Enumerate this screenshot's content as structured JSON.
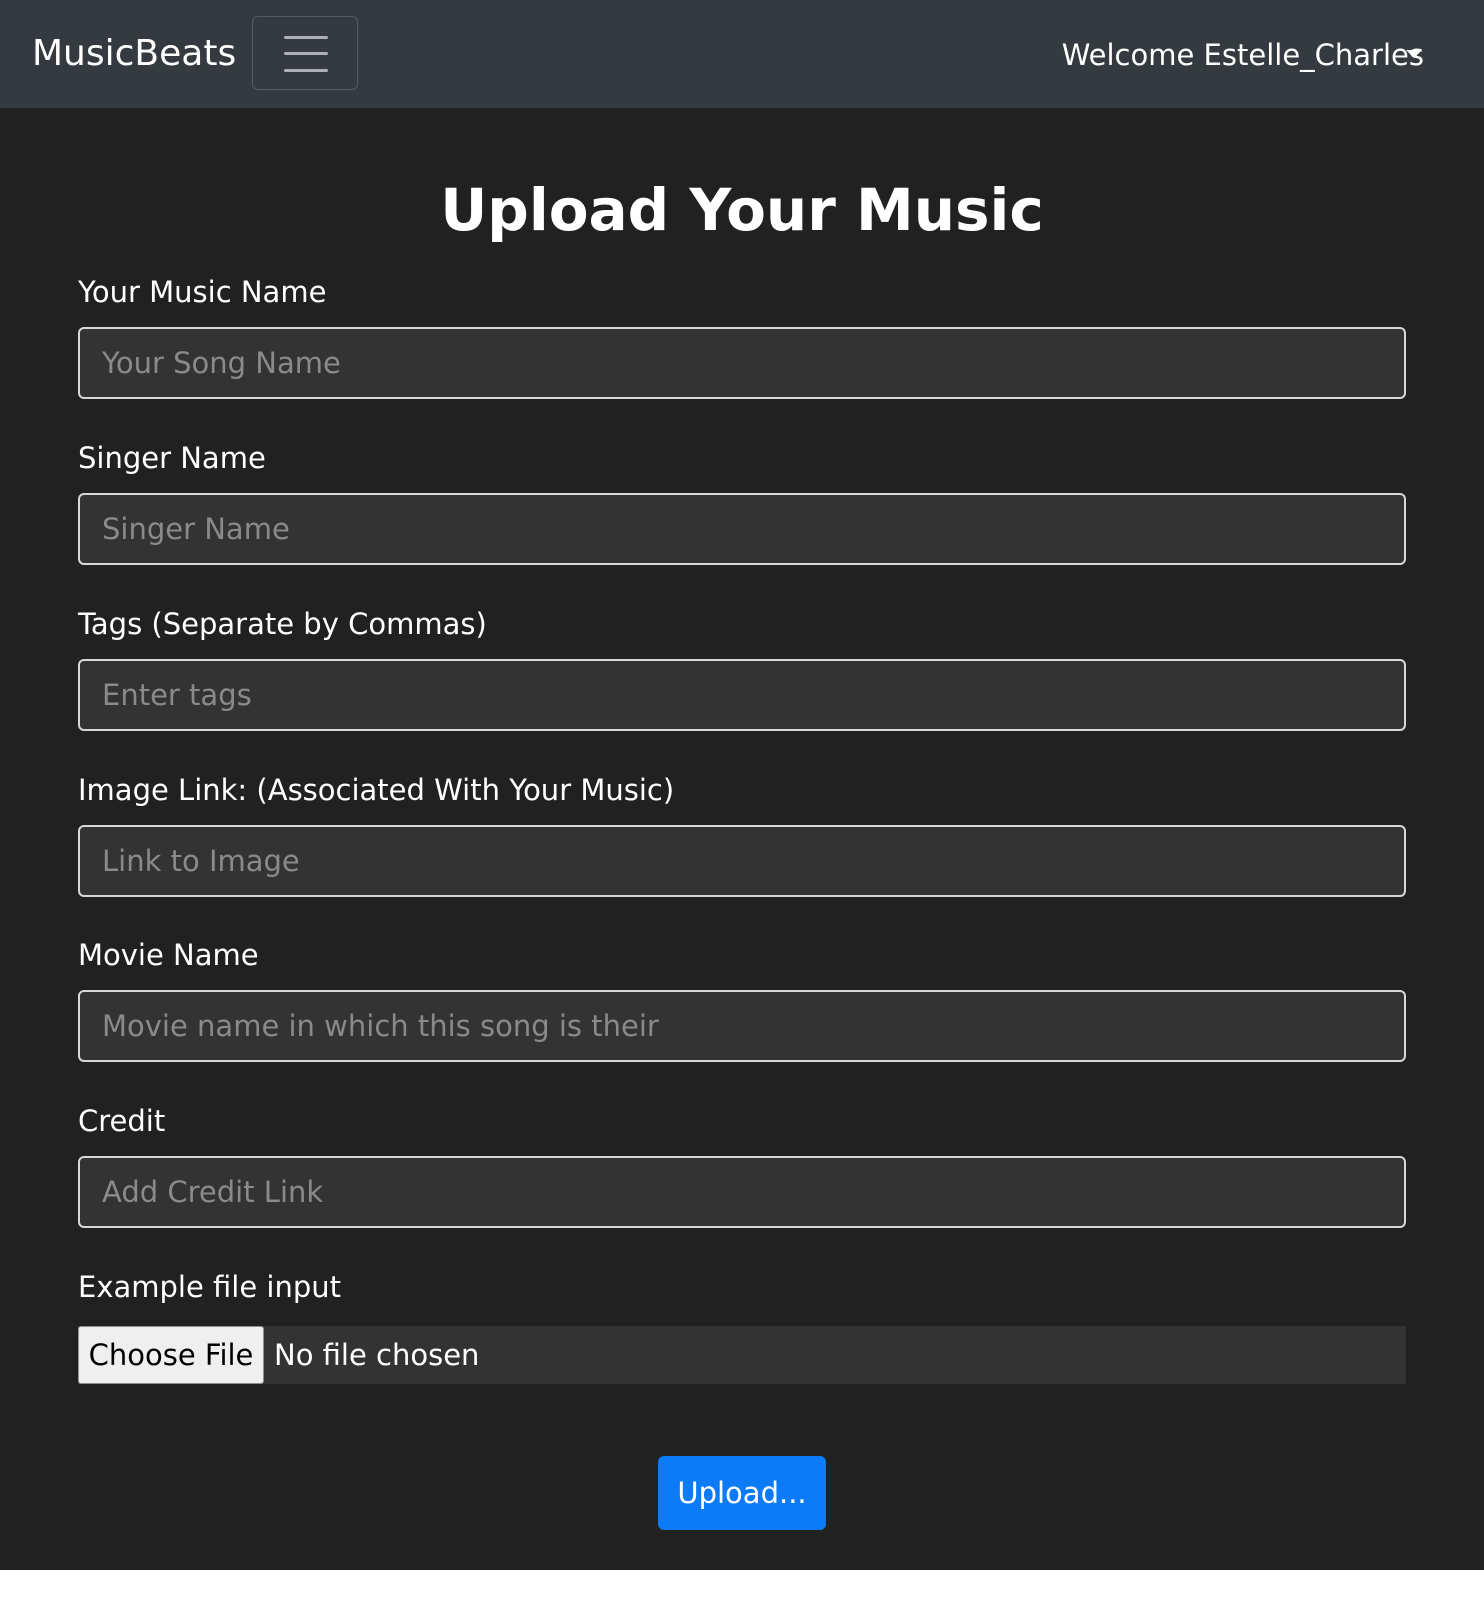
{
  "navbar": {
    "brand": "MusicBeats",
    "welcome": "Welcome Estelle_Charles"
  },
  "form": {
    "title": "Upload Your Music",
    "fields": [
      {
        "label": "Your Music Name",
        "placeholder": "Your Song Name",
        "value": ""
      },
      {
        "label": "Singer Name",
        "placeholder": "Singer Name",
        "value": ""
      },
      {
        "label": "Tags (Separate by Commas)",
        "placeholder": "Enter tags",
        "value": ""
      },
      {
        "label": "Image Link: (Associated With Your Music)",
        "placeholder": "Link to Image",
        "value": ""
      },
      {
        "label": "Movie Name",
        "placeholder": "Movie name in which this song is their",
        "value": ""
      },
      {
        "label": "Credit",
        "placeholder": "Add Credit Link",
        "value": ""
      }
    ],
    "file_input": {
      "label": "Example file input",
      "button_label": "Choose File",
      "status": "No file chosen"
    },
    "submit_label": "Upload..."
  },
  "colors": {
    "navbar_bg": "#343a40",
    "page_bg": "#212121",
    "input_bg": "#333333",
    "primary": "#0d7bf7"
  },
  "icons": {
    "menu": "hamburger-menu-icon",
    "dropdown": "caret-down-icon"
  }
}
